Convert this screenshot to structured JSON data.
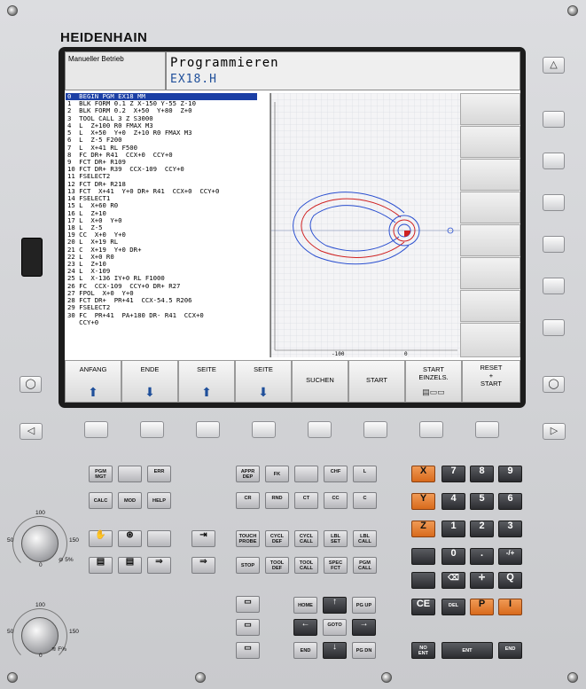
{
  "brand": "HEIDENHAIN",
  "header": {
    "mode": "Manueller Betrieb",
    "title": "Programmieren",
    "file": "EX18.H"
  },
  "program_lines": [
    "0  BEGIN PGM EX18 MM",
    "1  BLK FORM 0.1 Z X-150 Y-55 Z-10",
    "2  BLK FORM 0.2  X+50  Y+80  Z+0",
    "3  TOOL CALL 3 Z S3000",
    "4  L  Z+100 R0 FMAX M3",
    "5  L  X+50  Y+0  Z+10 R0 FMAX M3",
    "6  L  Z-5 F200",
    "7  L  X+41 RL F500",
    "8  FC DR+ R41  CCX+0  CCY+0",
    "9  FCT DR+ R109",
    "10 FCT DR+ R39  CCX-109  CCY+0",
    "11 FSELECT2",
    "12 FCT DR+ R218",
    "13 FCT  X+41  Y+0 DR+ R41  CCX+0  CCY+0",
    "14 FSELECT1",
    "15 L  X+60 R0",
    "16 L  Z+10",
    "17 L  X+0  Y+0",
    "18 L  Z-5",
    "19 CC  X+0  Y+0",
    "20 L  X+19 RL",
    "21 C  X+19  Y+0 DR+",
    "22 L  X+0 R0",
    "23 L  Z+10",
    "24 L  X-109",
    "25 L  X-136 IY+0 RL F1000",
    "26 FC  CCX-109  CCY+0 DR+ R27",
    "27 FPOL  X+0  Y+0",
    "28 FCT DR+  PR+41  CCX-54.5 R206",
    "29 FSELECT2",
    "30 FC  PR+41  PA+180 DR- R41  CCX+0",
    "   CCY+0"
  ],
  "graphic": {
    "axis_labels": [
      "-100",
      "0"
    ],
    "accent_blue": "#2a4fd0",
    "accent_red": "#d02020"
  },
  "softkeys": [
    {
      "label": "ANFANG",
      "icon": "arrow-up-icon"
    },
    {
      "label": "ENDE",
      "icon": "arrow-down-icon"
    },
    {
      "label": "SEITE",
      "icon": "arrow-up-icon"
    },
    {
      "label": "SEITE",
      "icon": "arrow-down-icon"
    },
    {
      "label": "SUCHEN",
      "icon": ""
    },
    {
      "label": "START",
      "icon": ""
    },
    {
      "label": "START\nEINZELS.",
      "icon": ""
    },
    {
      "label": "RESET\n+\nSTART",
      "icon": ""
    }
  ],
  "keys": {
    "row1": [
      "PGM\nMGT",
      "",
      "ERR"
    ],
    "row2": [
      "CALC",
      "MOD",
      "HELP"
    ],
    "prog_row1": [
      "APPR\nDEP",
      "FK",
      "",
      "CHF",
      "L"
    ],
    "prog_row2": [
      "CR",
      "RND",
      "CT",
      "CC",
      "C"
    ],
    "prog_row3": [
      "TOUCH\nPROBE",
      "CYCL\nDEF",
      "CYCL\nCALL",
      "LBL\nSET",
      "LBL\nCALL"
    ],
    "prog_row4": [
      "STOP",
      "TOOL\nDEF",
      "TOOL\nCALL",
      "SPEC\nFCT",
      "PGM\nCALL"
    ],
    "nav_row1": [
      "HOME",
      "↑",
      "PG UP"
    ],
    "nav_row2": [
      "←",
      "GOTO",
      "→"
    ],
    "nav_row3": [
      "END",
      "↓",
      "PG DN"
    ],
    "axes": [
      "X",
      "Y",
      "Z"
    ],
    "numpad": [
      "7",
      "8",
      "9",
      "4",
      "5",
      "6",
      "1",
      "2",
      "3",
      "0",
      ".",
      "-/+"
    ],
    "bottom_row": [
      "CE",
      "DEL",
      "P",
      "I"
    ],
    "enter_row": [
      "NO\nENT",
      "ENT",
      "END"
    ],
    "q_key": "Q"
  },
  "overrides": [
    {
      "scale": [
        "100",
        "50",
        "150",
        "0"
      ],
      "label": "5%"
    },
    {
      "scale": [
        "100",
        "50",
        "150",
        "0"
      ],
      "label": "F%"
    }
  ]
}
